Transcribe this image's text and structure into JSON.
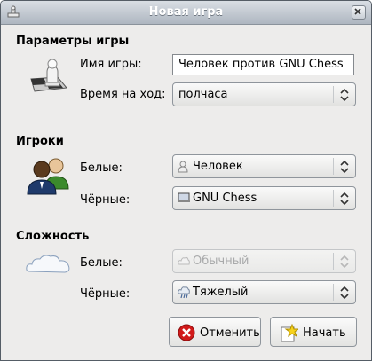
{
  "window": {
    "title": "Новая игра"
  },
  "game_params": {
    "heading": "Параметры игры",
    "name_label": "Имя игры:",
    "name_value": "Человек против GNU Chess",
    "time_label": "Время на ход:",
    "time_value": "полчаса"
  },
  "players": {
    "heading": "Игроки",
    "white_label": "Белые:",
    "white_value": "Человек",
    "black_label": "Чёрные:",
    "black_value": "GNU Chess"
  },
  "difficulty": {
    "heading": "Сложность",
    "white_label": "Белые:",
    "white_value": "Обычный",
    "black_label": "Чёрные:",
    "black_value": "Тяжелый"
  },
  "buttons": {
    "cancel": "Отменить",
    "start": "Начать"
  }
}
